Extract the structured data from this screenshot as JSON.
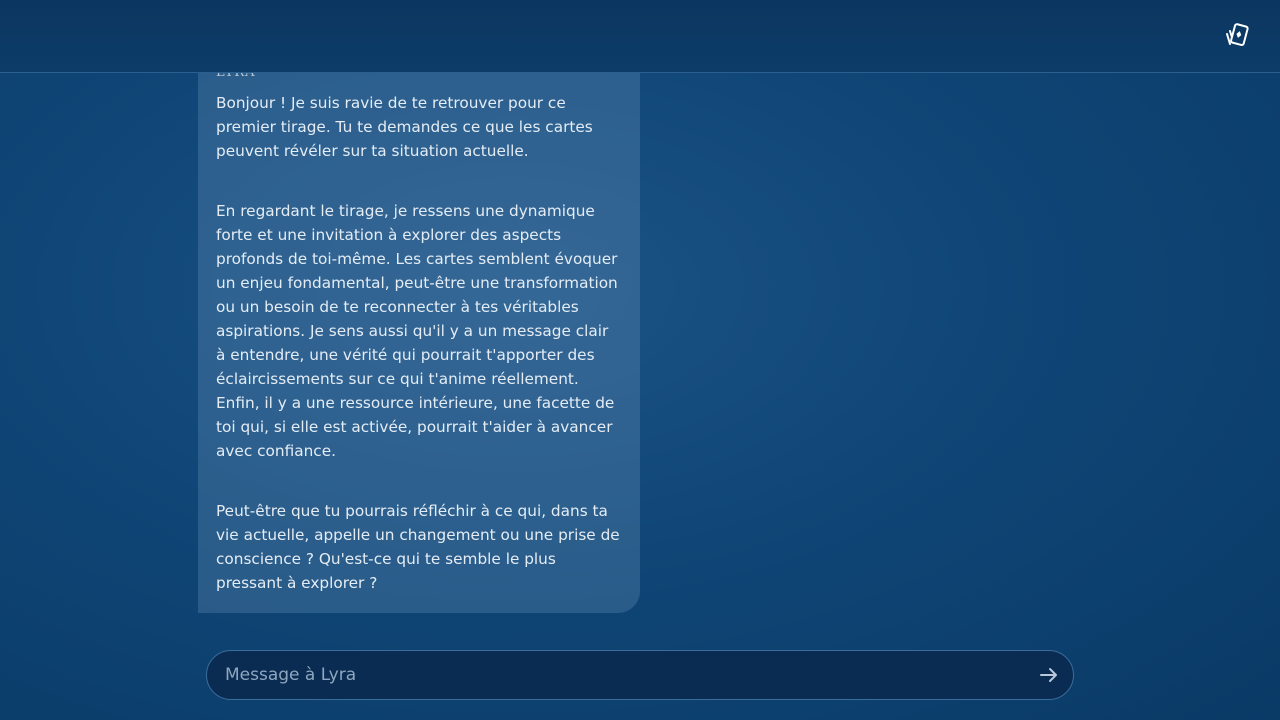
{
  "header": {
    "icon": "cards-icon"
  },
  "conversation": {
    "sender": "LYRA",
    "paragraphs": [
      "Bonjour ! Je suis ravie de te retrouver pour ce premier tirage. Tu te demandes ce que les cartes peuvent révéler sur ta situation actuelle.",
      "En regardant le tirage, je ressens une dynamique forte et une invitation à explorer des aspects profonds de toi-même. Les cartes semblent évoquer un enjeu fondamental, peut-être une transformation ou un besoin de te reconnecter à tes véritables aspirations. Je sens aussi qu'il y a un message clair à entendre, une vérité qui pourrait t'apporter des éclaircissements sur ce qui t'anime réellement. Enfin, il y a une ressource intérieure, une facette de toi qui, si elle est activée, pourrait t'aider à avancer avec confiance.",
      "Peut-être que tu pourrais réfléchir à ce qui, dans ta vie actuelle, appelle un changement ou une prise de conscience ? Qu'est-ce qui te semble le plus pressant à explorer ?"
    ]
  },
  "composer": {
    "placeholder": "Message à Lyra",
    "value": "",
    "send_icon": "arrow-right-icon"
  },
  "colors": {
    "background": "#0f4677",
    "bubble": "#3a6a96",
    "text": "#e4ecf4"
  }
}
